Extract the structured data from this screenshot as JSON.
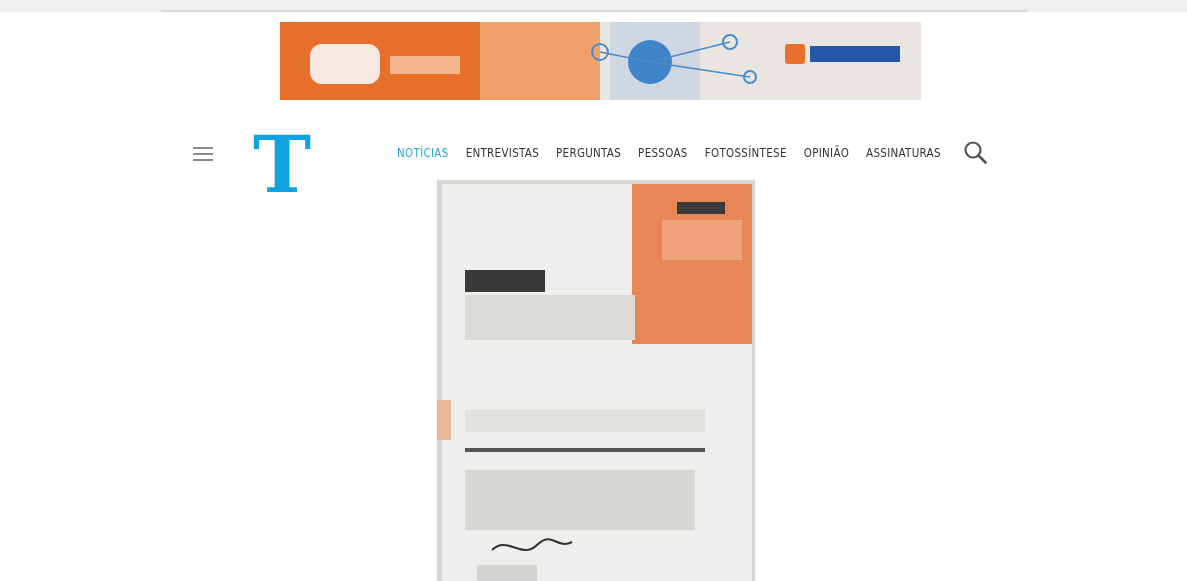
{
  "logo": {
    "text": "T"
  },
  "nav": [
    {
      "label": "NOTÍCIAS",
      "selected": true
    },
    {
      "label": "ENTREVISTAS",
      "selected": false
    },
    {
      "label": "PERGUNTAS",
      "selected": false
    },
    {
      "label": "PESSOAS",
      "selected": false
    },
    {
      "label": "FOTOSSÍNTESE",
      "selected": false
    },
    {
      "label": "OPINIÃO",
      "selected": false
    },
    {
      "label": "ASSINATURAS",
      "selected": false
    }
  ]
}
